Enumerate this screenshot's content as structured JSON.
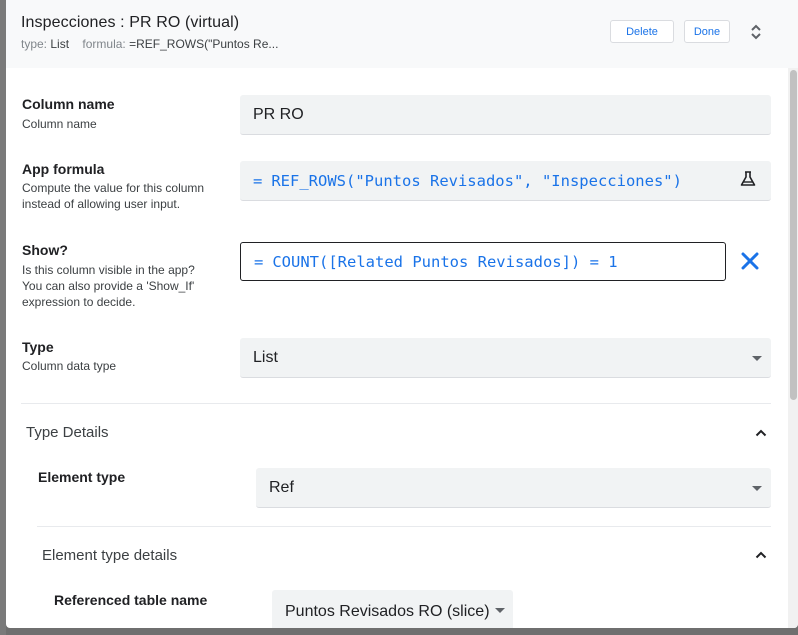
{
  "header": {
    "title": "Inspecciones : PR RO (virtual)",
    "type_label": "type:",
    "type_value": "List",
    "formula_label": "formula:",
    "formula_value": "=REF_ROWS(\"Puntos Re...",
    "delete_label": "Delete",
    "done_label": "Done"
  },
  "fields": {
    "column_name": {
      "title": "Column name",
      "description": "Column name",
      "value": "PR RO"
    },
    "app_formula": {
      "title": "App formula",
      "description_line1": "Compute the value for this column",
      "description_line2": "instead of allowing user input.",
      "eq": "=",
      "value": "REF_ROWS(\"Puntos Revisados\", \"Inspecciones\")"
    },
    "show": {
      "title": "Show?",
      "description_line1": "Is this column visible in the app?",
      "description_line2": "You can also provide a 'Show_If'",
      "description_line3": "expression to decide.",
      "eq": "=",
      "value": "COUNT([Related Puntos Revisados]) = 1"
    },
    "type": {
      "title": "Type",
      "description": "Column data type",
      "value": "List"
    }
  },
  "type_details": {
    "section_title": "Type Details",
    "element_type": {
      "title": "Element type",
      "value": "Ref"
    },
    "element_type_details": {
      "section_title": "Element type details",
      "referenced_table": {
        "title": "Referenced table name",
        "value": "Puntos Revisados RO (slice)"
      }
    }
  },
  "icons": {
    "expand": "unfold-more-icon",
    "flask": "flask-icon",
    "clear": "close-icon",
    "chevron": "chevron-up-icon",
    "dropdown": "arrow-drop-down-icon"
  },
  "colors": {
    "accent": "#1a73e8",
    "field_bg": "#f1f3f4",
    "header_bg": "#f8f9fa"
  }
}
